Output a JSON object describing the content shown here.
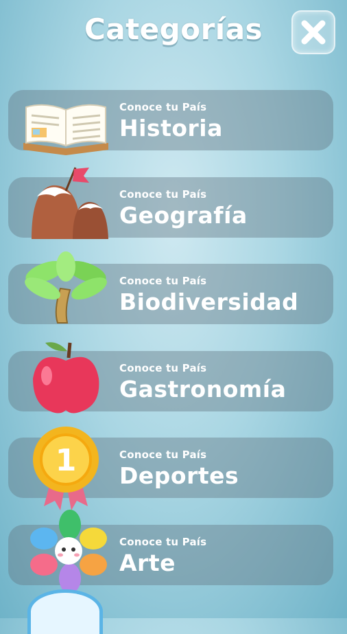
{
  "header": {
    "title": "Categorías",
    "close_icon": "close-icon"
  },
  "categories": [
    {
      "subtitle": "Conoce tu País",
      "label": "Historia",
      "icon": "book-icon"
    },
    {
      "subtitle": "Conoce tu País",
      "label": "Geografía",
      "icon": "mountain-flag-icon"
    },
    {
      "subtitle": "Conoce tu País",
      "label": "Biodiversidad",
      "icon": "palm-tree-icon"
    },
    {
      "subtitle": "Conoce tu País",
      "label": "Gastronomía",
      "icon": "apple-icon"
    },
    {
      "subtitle": "Conoce tu País",
      "label": "Deportes",
      "icon": "medal-icon"
    },
    {
      "subtitle": "Conoce tu País",
      "label": "Arte",
      "icon": "flower-icon"
    }
  ],
  "colors": {
    "accent": "#ffffff",
    "card": "#64788a",
    "background": "#a9d6e3"
  }
}
